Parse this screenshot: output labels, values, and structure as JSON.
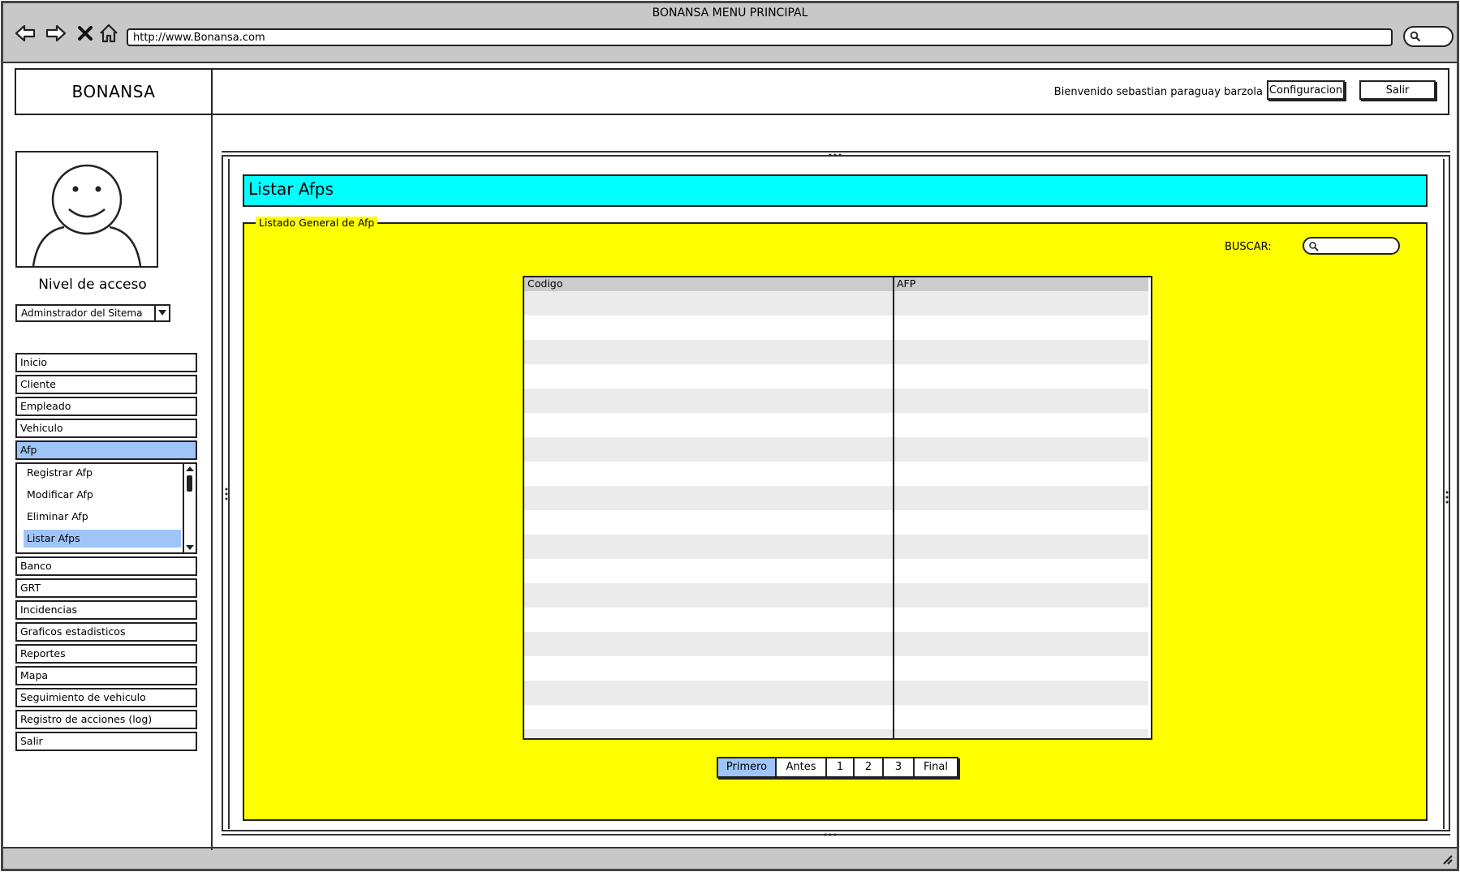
{
  "window": {
    "title": "BONANSA MENU PRINCIPAL",
    "url": "http://www.Bonansa.com"
  },
  "header": {
    "brand": "BONANSA",
    "welcome": "Bienvenido sebastian paraguay barzola",
    "config_label": "Configuracion",
    "salir_label": "Salir"
  },
  "sidebar": {
    "access_label": "Nivel de acceso",
    "access_value": "Adminstrador del Sitema",
    "menu_top": [
      {
        "label": "Inicio"
      },
      {
        "label": "Cliente"
      },
      {
        "label": "Empleado"
      },
      {
        "label": "Vehiculo"
      },
      {
        "label": "Afp"
      }
    ],
    "submenu": [
      {
        "label": "Registrar Afp"
      },
      {
        "label": "Modificar Afp"
      },
      {
        "label": "Eliminar Afp"
      },
      {
        "label": "Listar Afps"
      }
    ],
    "menu_bottom": [
      {
        "label": "Banco"
      },
      {
        "label": "GRT"
      },
      {
        "label": "Incidencias"
      },
      {
        "label": "Graficos estadisticos"
      },
      {
        "label": "Reportes"
      },
      {
        "label": "Mapa"
      },
      {
        "label": "Seguimiento de vehiculo"
      },
      {
        "label": "Registro de acciones (log)"
      },
      {
        "label": "Salir"
      }
    ]
  },
  "main": {
    "page_title": "Listar Afps",
    "fieldset_legend": "Listado General de Afp",
    "search_label": "BUSCAR:",
    "table": {
      "columns": [
        "Codigo",
        "AFP"
      ]
    },
    "pager": [
      "Primero",
      "Antes",
      "1",
      "2",
      "3",
      "Final"
    ]
  }
}
